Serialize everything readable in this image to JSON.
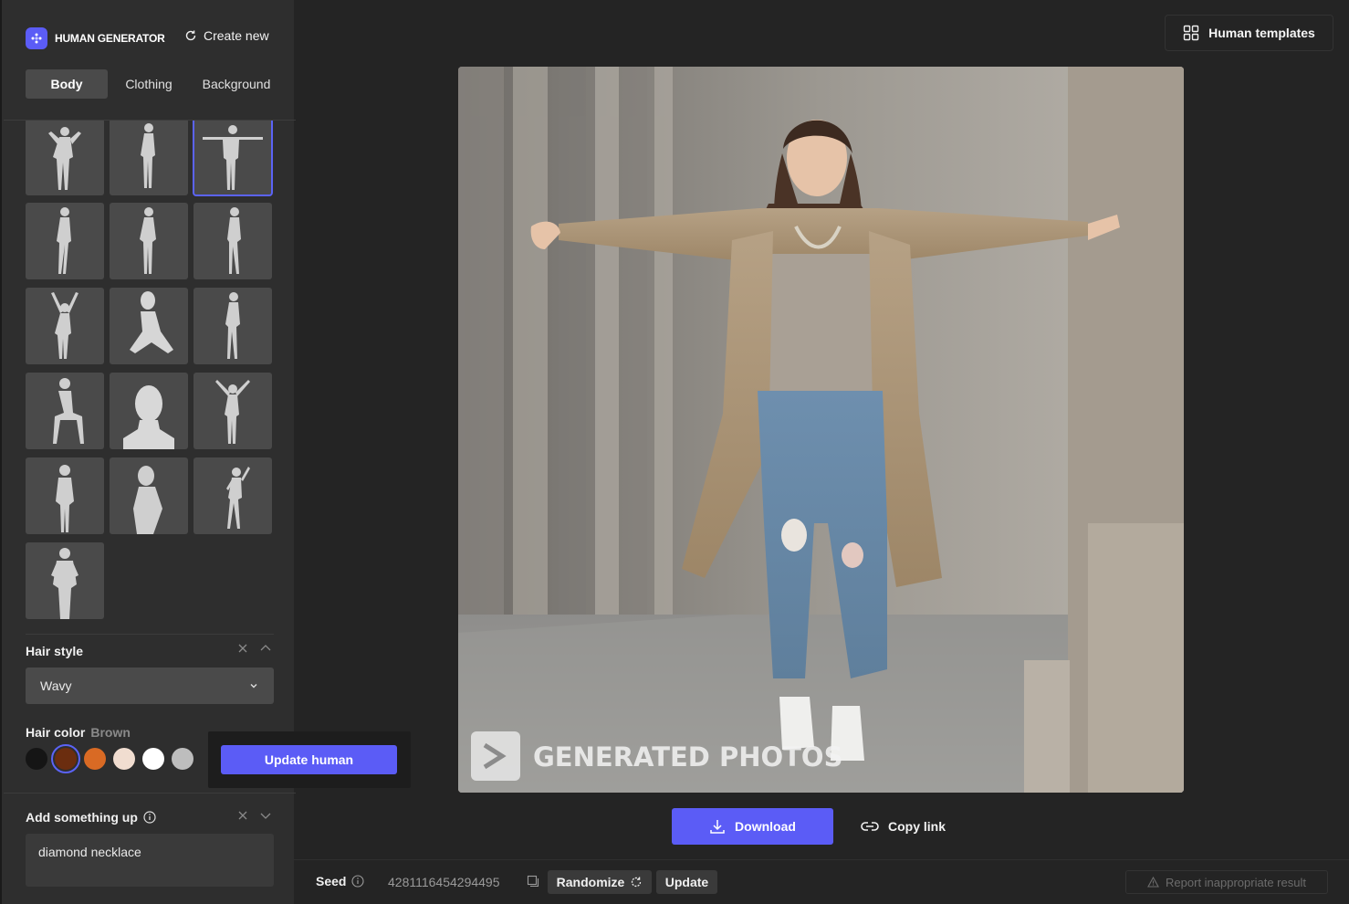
{
  "brand": {
    "name": "HUMAN GENERATOR",
    "icon": "sparkle-logo-icon",
    "accent": "#5b5cf6"
  },
  "header": {
    "create_new": "Create new",
    "templates": "Human templates"
  },
  "tabs": [
    {
      "label": "Body",
      "active": true
    },
    {
      "label": "Clothing",
      "active": false
    },
    {
      "label": "Background",
      "active": false
    }
  ],
  "poses": {
    "count": 16,
    "selected_index": 2
  },
  "hair_style": {
    "title": "Hair style",
    "value": "Wavy"
  },
  "hair_color": {
    "title": "Hair color",
    "selected_name": "Brown",
    "swatches": [
      "#151515",
      "#6b2d0f",
      "#d96a24",
      "#f1ddd0",
      "#ffffff",
      "#bdbdbd"
    ],
    "selected_index": 1
  },
  "update_human": "Update human",
  "add_something": {
    "title": "Add something up",
    "value": "diamond necklace"
  },
  "image": {
    "watermark": "GENERATED PHOTOS"
  },
  "actions": {
    "download": "Download",
    "copy_link": "Copy link"
  },
  "footer": {
    "seed_label": "Seed",
    "seed_value": "4281116454294495",
    "randomize": "Randomize",
    "update": "Update",
    "report": "Report inappropriate result"
  }
}
